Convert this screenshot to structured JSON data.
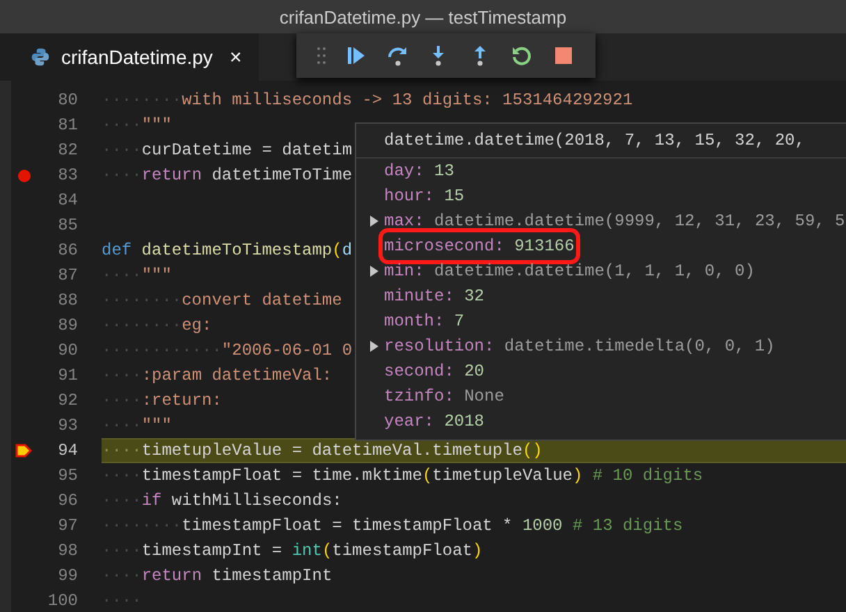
{
  "window": {
    "title": "crifanDatetime.py — testTimestamp"
  },
  "tabs": [
    {
      "label": "crifanDatetime.py",
      "close": "×",
      "selected": true
    }
  ],
  "lines": [
    {
      "number": "80",
      "indent": "········",
      "breakpoint": false,
      "current": false,
      "tokens": [
        {
          "kind": "string",
          "text": "with milliseconds -> 13 digits: 1531464292921"
        }
      ]
    },
    {
      "number": "81",
      "indent": "····",
      "breakpoint": false,
      "current": false,
      "tokens": [
        {
          "kind": "string",
          "text": "\"\"\""
        }
      ]
    },
    {
      "number": "82",
      "indent": "····",
      "breakpoint": false,
      "current": false,
      "tokens": [
        {
          "kind": "plain",
          "text": "curDatetime = datetim"
        }
      ]
    },
    {
      "number": "83",
      "indent": "····",
      "breakpoint": true,
      "current": false,
      "tokens": [
        {
          "kind": "keyword",
          "text": "return"
        },
        {
          "kind": "plain",
          "text": " datetimeToTime"
        }
      ]
    },
    {
      "number": "84",
      "breakpoint": false,
      "current": false
    },
    {
      "number": "85",
      "breakpoint": false,
      "current": false
    },
    {
      "number": "86",
      "breakpoint": false,
      "current": false,
      "tokens": [
        {
          "kind": "storage",
          "text": "def"
        },
        {
          "kind": "function",
          "text": " datetimeToTimestamp"
        },
        {
          "kind": "paren",
          "text": "("
        },
        {
          "kind": "param",
          "text": "d"
        }
      ]
    },
    {
      "number": "87",
      "indent": "····",
      "breakpoint": false,
      "current": false,
      "tokens": [
        {
          "kind": "string",
          "text": "\"\"\""
        }
      ]
    },
    {
      "number": "88",
      "indent": "········",
      "breakpoint": false,
      "current": false,
      "tokens": [
        {
          "kind": "string",
          "text": "convert datetime"
        }
      ]
    },
    {
      "number": "89",
      "indent": "········",
      "breakpoint": false,
      "current": false,
      "tokens": [
        {
          "kind": "string",
          "text": "eg:"
        }
      ]
    },
    {
      "number": "90",
      "indent": "············",
      "breakpoint": false,
      "current": false,
      "tokens": [
        {
          "kind": "string",
          "text": "\"2006-06-01 0"
        }
      ]
    },
    {
      "number": "91",
      "indent": "····",
      "breakpoint": false,
      "current": false,
      "tokens": [
        {
          "kind": "string",
          "text": ":param datetimeVal:"
        }
      ]
    },
    {
      "number": "92",
      "indent": "····",
      "breakpoint": false,
      "current": false,
      "tokens": [
        {
          "kind": "string",
          "text": ":return:"
        }
      ]
    },
    {
      "number": "93",
      "indent": "····",
      "breakpoint": false,
      "current": false,
      "tokens": [
        {
          "kind": "string",
          "text": "\"\"\""
        }
      ]
    },
    {
      "number": "94",
      "indent": "····",
      "breakpoint": false,
      "current": true,
      "tokens": [
        {
          "kind": "plain",
          "text": "timetupleValue = datetimeVal.timetuple"
        },
        {
          "kind": "paren",
          "text": "()"
        }
      ]
    },
    {
      "number": "95",
      "indent": "····",
      "breakpoint": false,
      "current": false,
      "tokens": [
        {
          "kind": "plain",
          "text": "timestampFloat = time.mktime"
        },
        {
          "kind": "paren",
          "text": "("
        },
        {
          "kind": "plain",
          "text": "timetupleValue"
        },
        {
          "kind": "paren",
          "text": ")"
        },
        {
          "kind": "comment",
          "text": " # 10 digits"
        }
      ]
    },
    {
      "number": "96",
      "indent": "····",
      "breakpoint": false,
      "current": false,
      "tokens": [
        {
          "kind": "keyword",
          "text": "if"
        },
        {
          "kind": "plain",
          "text": " withMilliseconds:"
        }
      ]
    },
    {
      "number": "97",
      "indent": "········",
      "breakpoint": false,
      "current": false,
      "tokens": [
        {
          "kind": "plain",
          "text": "timestampFloat = timestampFloat * "
        },
        {
          "kind": "number",
          "text": "1000"
        },
        {
          "kind": "comment",
          "text": " # 13 digits"
        }
      ]
    },
    {
      "number": "98",
      "indent": "····",
      "breakpoint": false,
      "current": false,
      "tokens": [
        {
          "kind": "plain",
          "text": "timestampInt = "
        },
        {
          "kind": "builtin",
          "text": "int"
        },
        {
          "kind": "paren",
          "text": "("
        },
        {
          "kind": "plain",
          "text": "timestampFloat"
        },
        {
          "kind": "paren",
          "text": ")"
        }
      ]
    },
    {
      "number": "99",
      "indent": "····",
      "breakpoint": false,
      "current": false,
      "tokens": [
        {
          "kind": "keyword",
          "text": "return"
        },
        {
          "kind": "plain",
          "text": " timestampInt"
        }
      ]
    },
    {
      "number": "100",
      "indent": "····",
      "breakpoint": false,
      "current": false
    }
  ],
  "hover": {
    "header": "datetime.datetime(2018, 7, 13, 15, 32, 20,",
    "rows": [
      {
        "key": "day:",
        "value": "13",
        "kind": "number",
        "expandable": false,
        "highlighted": false
      },
      {
        "key": "hour:",
        "value": "15",
        "kind": "number",
        "expandable": false,
        "highlighted": false
      },
      {
        "key": "max:",
        "value": "datetime.datetime(9999, 12, 31, 23, 59, 5",
        "kind": "object",
        "expandable": true,
        "highlighted": false
      },
      {
        "key": "microsecond:",
        "value": "913166",
        "kind": "number",
        "expandable": false,
        "highlighted": true
      },
      {
        "key": "min:",
        "value": "datetime.datetime(1, 1, 1, 0, 0)",
        "kind": "object",
        "expandable": true,
        "highlighted": false
      },
      {
        "key": "minute:",
        "value": "32",
        "kind": "number",
        "expandable": false,
        "highlighted": false
      },
      {
        "key": "month:",
        "value": "7",
        "kind": "number",
        "expandable": false,
        "highlighted": false
      },
      {
        "key": "resolution:",
        "value": "datetime.timedelta(0, 0, 1)",
        "kind": "object",
        "expandable": true,
        "highlighted": false
      },
      {
        "key": "second:",
        "value": "20",
        "kind": "number",
        "expandable": false,
        "highlighted": false
      },
      {
        "key": "tzinfo:",
        "value": "None",
        "kind": "none",
        "expandable": false,
        "highlighted": false
      },
      {
        "key": "year:",
        "value": "2018",
        "kind": "number",
        "expandable": false,
        "highlighted": false
      }
    ]
  }
}
